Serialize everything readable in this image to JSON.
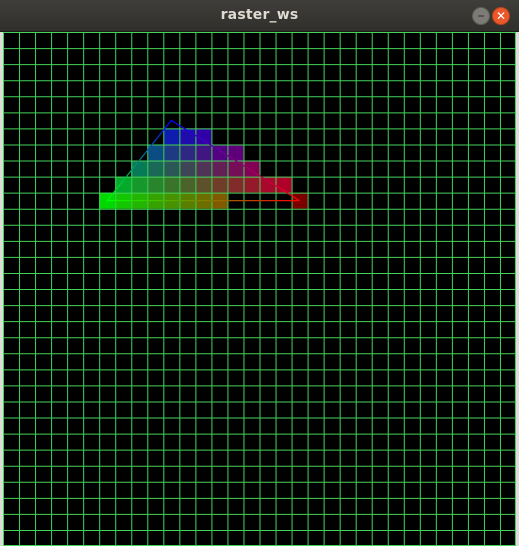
{
  "window": {
    "title": "raster_ws",
    "minimize_icon": "minimize-icon",
    "close_icon": "close-icon",
    "minimize_glyph": "–",
    "close_glyph": "✕"
  },
  "canvas": {
    "background": "#000000",
    "grid_color": "#44d45a",
    "grid_rows": 32,
    "grid_cols": 32,
    "triangle_vertex_colors": {
      "top": "#0000ff",
      "left": "#00ff00",
      "right": "#ff0000"
    },
    "triangle_cells": [
      {
        "row": 6,
        "from": 10,
        "to": 12
      },
      {
        "row": 7,
        "from": 9,
        "to": 14
      },
      {
        "row": 8,
        "from": 8,
        "to": 15
      },
      {
        "row": 9,
        "from": 7,
        "to": 17
      },
      {
        "row": 10,
        "from": 6,
        "to": 13
      }
    ],
    "vertex_cell_right": {
      "row": 10,
      "col": 18
    },
    "outline_vertices": {
      "top": [
        10.5,
        5.5
      ],
      "left": [
        6.5,
        10.5
      ],
      "right": [
        18.5,
        10.5
      ]
    }
  }
}
